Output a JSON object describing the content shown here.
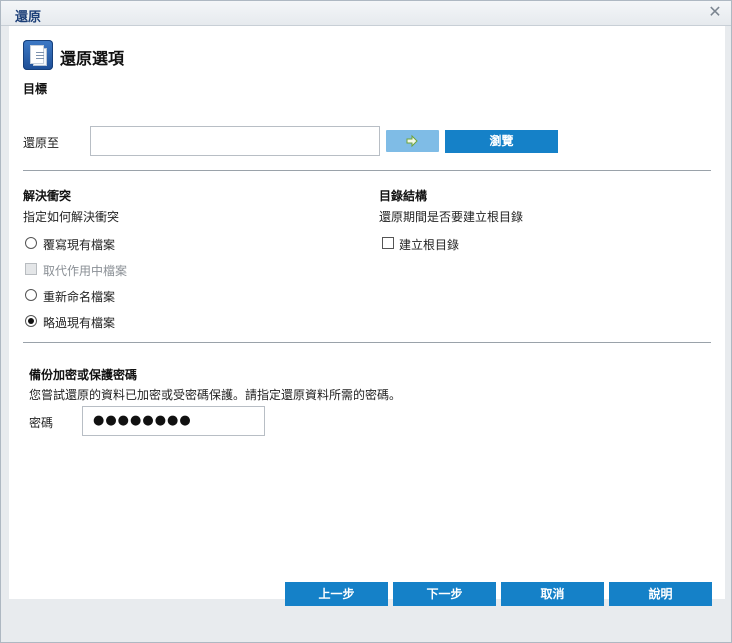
{
  "window": {
    "title": "還原",
    "close_glyph": "✕"
  },
  "header": {
    "title": "還原選項",
    "icon": "restore-document-icon"
  },
  "destination": {
    "section_label": "目標",
    "restore_to_label": "還原至",
    "path_value": "",
    "go_icon": "arrow-right-icon",
    "browse_label": "瀏覽"
  },
  "conflict": {
    "title": "解決衝突",
    "description": "指定如何解決衝突",
    "options": [
      {
        "label": "覆寫現有檔案",
        "type": "radio",
        "checked": false
      },
      {
        "label": "取代作用中檔案",
        "type": "checkbox",
        "checked": false,
        "disabled": true
      },
      {
        "label": "重新命名檔案",
        "type": "radio",
        "checked": false
      },
      {
        "label": "略過現有檔案",
        "type": "radio",
        "checked": true
      }
    ]
  },
  "directory": {
    "title": "目錄結構",
    "description": "還原期間是否要建立根目錄",
    "create_root_label": "建立根目錄",
    "create_root_checked": false
  },
  "password": {
    "title": "備份加密或保護密碼",
    "description": "您嘗試還原的資料已加密或受密碼保護。請指定還原資料所需的密碼。",
    "field_label": "密碼",
    "masked_value": "●●●●●●●●"
  },
  "footer": {
    "back_label": "上一步",
    "next_label": "下一步",
    "cancel_label": "取消",
    "help_label": "說明"
  },
  "colors": {
    "accent": "#1581c8",
    "accent_light": "#7fbce6",
    "title_text": "#1c3f78"
  }
}
